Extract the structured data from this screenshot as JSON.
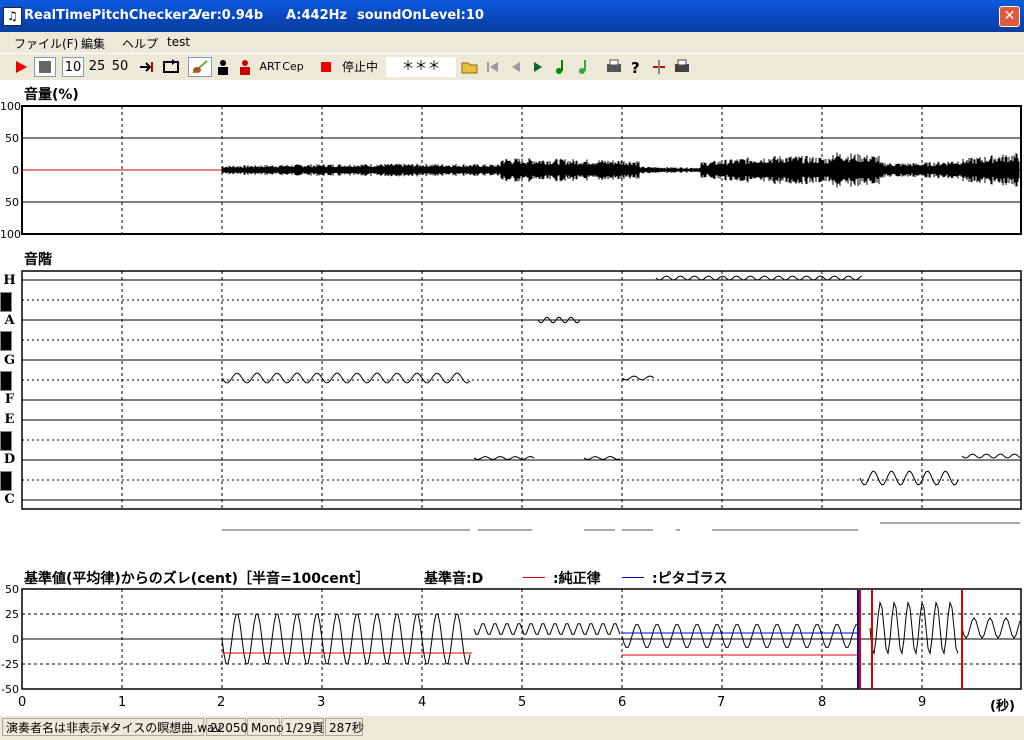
{
  "window": {
    "app_name": "RealTimePitchChecker2",
    "version": "Ver:0.94b",
    "a_freq": "A:442Hz",
    "sound_on": "soundOnLevel:10",
    "close": "✕",
    "icon": "music-note-icon"
  },
  "menu": [
    "ファイル(F)",
    "編集",
    "ヘルプ",
    "test"
  ],
  "toolbar": {
    "zoom": [
      "10",
      "25",
      "50"
    ],
    "art": "ART",
    "cep": "Cep",
    "state": "停止中",
    "display": "＊＊＊"
  },
  "volume": {
    "title": "音量(%)",
    "ticks": [
      "100",
      "50",
      "0",
      "50",
      "100"
    ]
  },
  "scale": {
    "title": "音階",
    "notes": [
      "H",
      "A",
      "G",
      "F",
      "E",
      "D",
      "C"
    ]
  },
  "deviation": {
    "title": "基準値(平均律)からのズレ(cent)［半音=100cent］",
    "base_note": "基準音:D",
    "just": ":純正律",
    "pyth": ":ピタゴラス",
    "ticks": [
      "50",
      "25",
      "0",
      "-25",
      "-50"
    ],
    "colors": {
      "just": "#e00000",
      "pyth": "#0000cc"
    }
  },
  "time_axis": {
    "labels": [
      "0",
      "1",
      "2",
      "3",
      "4",
      "5",
      "6",
      "7",
      "8",
      "9"
    ],
    "unit": "(秒)"
  },
  "status": {
    "file": "演奏者名は非表示¥タイスの瞑想曲.wav",
    "rate": "22050",
    "channels": "Mono",
    "page": "1/29頁",
    "length": "287秒"
  }
}
